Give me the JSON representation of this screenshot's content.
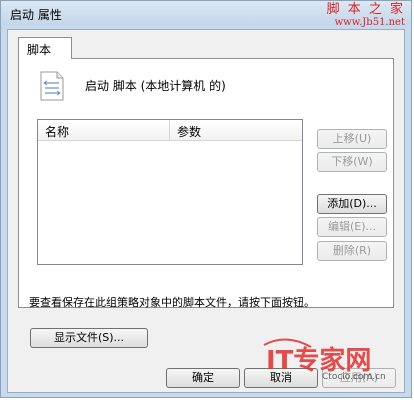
{
  "window": {
    "title": "启动 属性",
    "watermark_line1": "脚 本 之 家",
    "watermark_line2": "www.Jb51.net"
  },
  "tabs": [
    {
      "label": "脚本",
      "active": true
    }
  ],
  "panel": {
    "heading": "启动 脚本 (本地计算机 的)",
    "icon": "script-file-icon",
    "columns": [
      "名称",
      "参数"
    ],
    "rows": []
  },
  "side_buttons": {
    "move_up": {
      "label": "上移(U)",
      "enabled": false
    },
    "move_down": {
      "label": "下移(W)",
      "enabled": false
    },
    "add": {
      "label": "添加(D)...",
      "enabled": true
    },
    "edit": {
      "label": "编辑(E)...",
      "enabled": false
    },
    "remove": {
      "label": "删除(R)",
      "enabled": false
    }
  },
  "info_text": "要查看保存在此组策略对象中的脚本文件，请按下面按钮。",
  "show_files_label": "显示文件(S)...",
  "footer": {
    "ok": "确定",
    "cancel": "取消",
    "apply": "应用(A)"
  },
  "logo": {
    "text": "IT专家网",
    "url": "Ctocio.com.cn"
  },
  "colors": {
    "window_frame": "#c7d9ec",
    "client_bg": "#f0f0f0",
    "watermark_red": "#dd2222",
    "logo_red": "#e03030"
  }
}
